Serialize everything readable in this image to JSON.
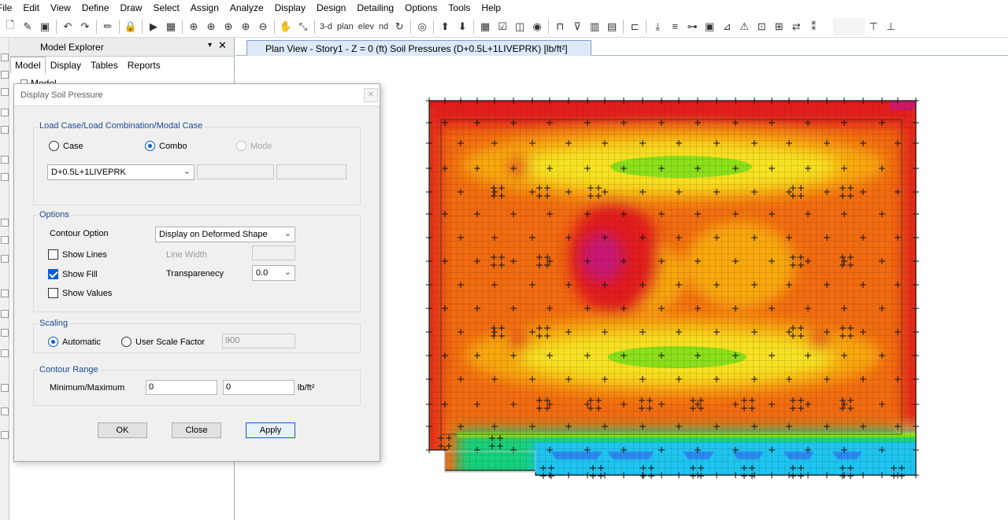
{
  "menu": [
    "File",
    "Edit",
    "View",
    "Define",
    "Draw",
    "Select",
    "Assign",
    "Analyze",
    "Display",
    "Design",
    "Detailing",
    "Options",
    "Tools",
    "Help"
  ],
  "toolbar": {
    "view_3d": "3-d",
    "view_plan": "plan",
    "view_elev": "elev",
    "view_nd": "nd"
  },
  "explorer": {
    "title": "Model Explorer",
    "pin": "▾",
    "close": "✕",
    "tabs": [
      "Model",
      "Display",
      "Tables",
      "Reports"
    ],
    "tree_root": "Model"
  },
  "document_tab": {
    "label": "Plan View - Story1 - Z = 0 (ft)   Soil Pressures   (D+0.5L+1LIVEPRK)  [lb/ft²]"
  },
  "dialog": {
    "title": "Display Soil Pressure",
    "close": "✕",
    "load_case": {
      "group_title": "Load Case/Load Combination/Modal Case",
      "radio_case": "Case",
      "radio_combo": "Combo",
      "radio_mode": "Mode",
      "selected": "combo",
      "combo_value": "D+0.5L+1LIVEPRK"
    },
    "options": {
      "group_title": "Options",
      "contour_option_label": "Contour Option",
      "contour_option_value": "Display on Deformed Shape",
      "show_lines": "Show Lines",
      "show_lines_checked": false,
      "show_fill": "Show Fill",
      "show_fill_checked": true,
      "show_values": "Show Values",
      "show_values_checked": false,
      "line_width_label": "Line Width",
      "transparency_label": "Transparenecy",
      "transparency_value": "0.0"
    },
    "scaling": {
      "group_title": "Scaling",
      "automatic": "Automatic",
      "user_scale": "User Scale Factor",
      "selected": "automatic",
      "scale_value": "900"
    },
    "contour_range": {
      "group_title": "Contour Range",
      "label": "Minimum/Maximum",
      "min": "0",
      "max": "0",
      "units": "lb/ft²"
    },
    "buttons": {
      "ok": "OK",
      "close": "Close",
      "apply": "Apply"
    }
  },
  "colors": {
    "accent": "#0a5cd6",
    "contour_max": "#c71585",
    "contour_high": "#e31b1b",
    "contour_mid_high": "#f26b10",
    "contour_mid": "#f9a90b",
    "contour_mid_low": "#f7e321",
    "contour_low": "#8ce01a",
    "contour_lower": "#18d27c",
    "contour_min": "#1ec5f0",
    "contour_blue": "#2a8bf0"
  }
}
